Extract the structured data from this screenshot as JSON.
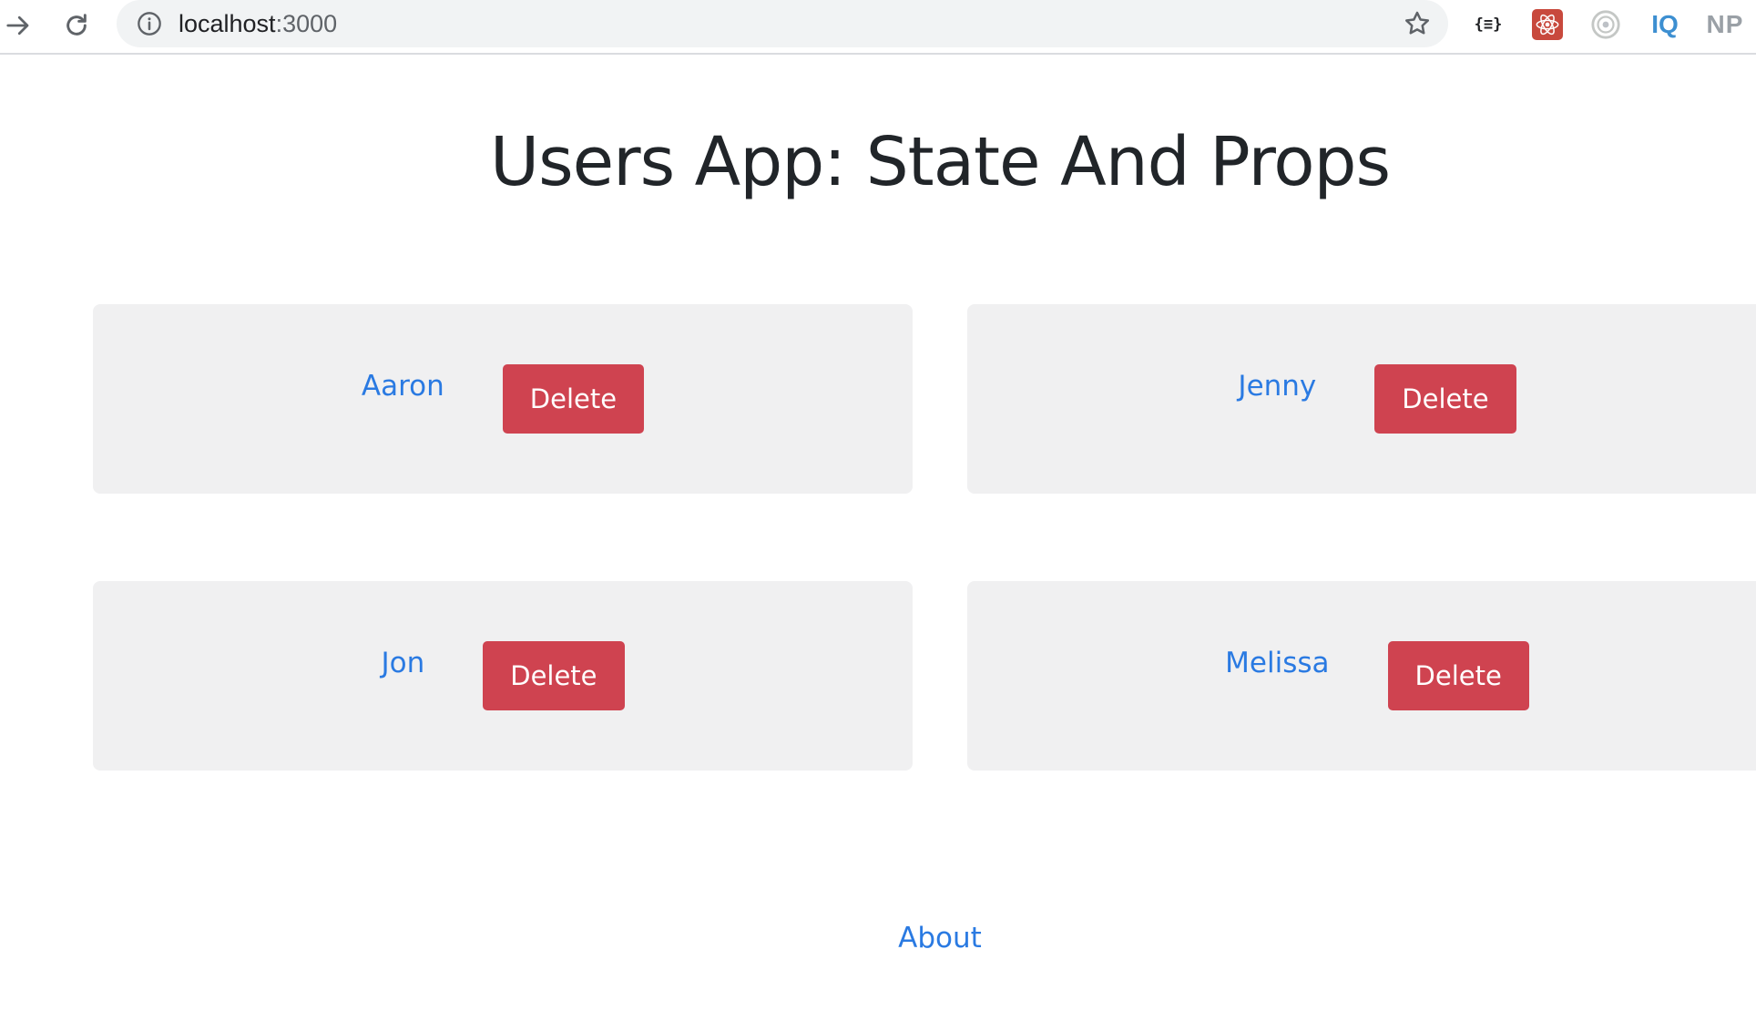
{
  "browser": {
    "url_host": "localhost",
    "url_port": ":3000",
    "extensions": {
      "json": "{≡}",
      "iq": "IQ",
      "np": "NP"
    }
  },
  "page": {
    "title": "Users App: State And Props",
    "users": [
      {
        "name": "Aaron",
        "delete_label": "Delete"
      },
      {
        "name": "Jenny",
        "delete_label": "Delete"
      },
      {
        "name": "Jon",
        "delete_label": "Delete"
      },
      {
        "name": "Melissa",
        "delete_label": "Delete"
      }
    ],
    "about_label": "About"
  },
  "colors": {
    "link": "#2a7ae2",
    "danger": "#cf4350",
    "card_bg": "#f0f0f1",
    "title": "#212529"
  }
}
